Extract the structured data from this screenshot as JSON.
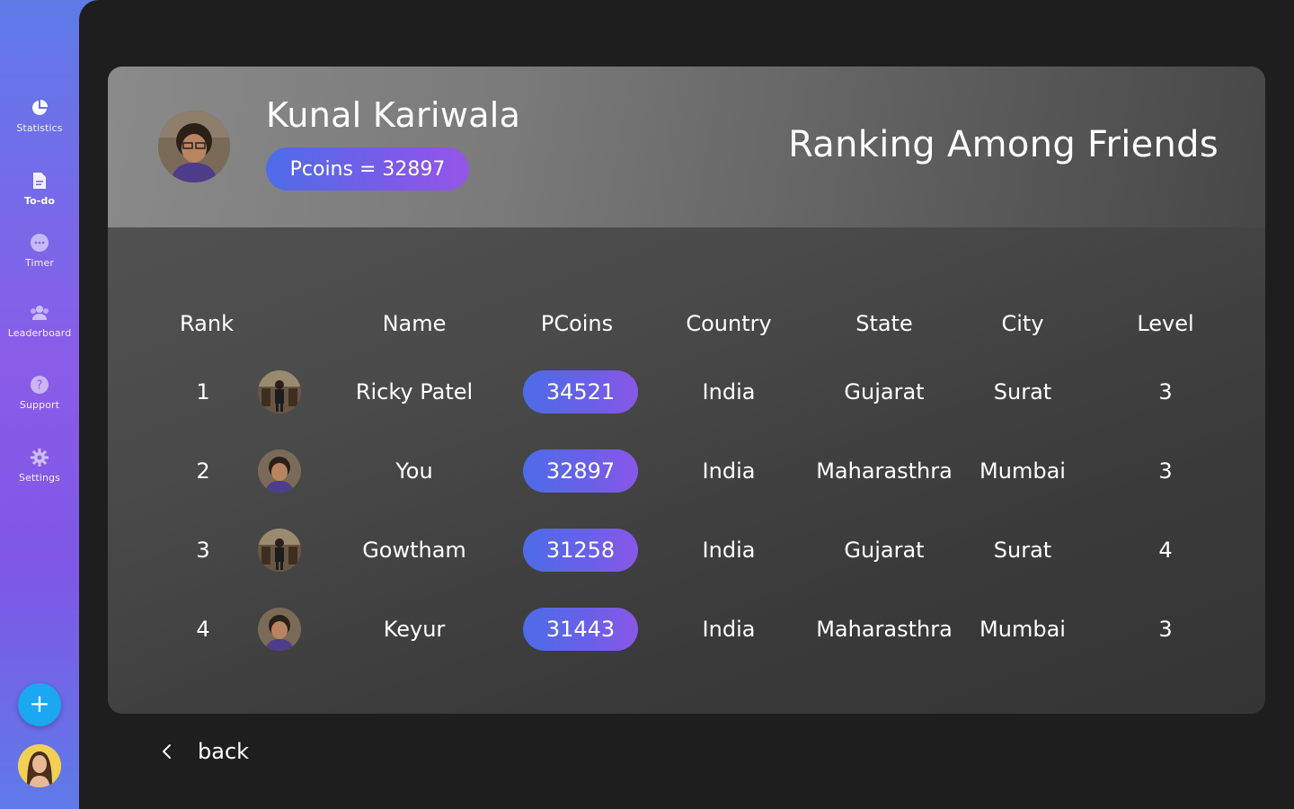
{
  "sidebar": {
    "items": [
      {
        "label": "Statistics",
        "icon": "pie-chart-icon"
      },
      {
        "label": "To-do",
        "icon": "document-icon"
      },
      {
        "label": "Timer",
        "icon": "chat-bubble-icon"
      },
      {
        "label": "Leaderboard",
        "icon": "group-icon"
      },
      {
        "label": "Support",
        "icon": "help-icon"
      },
      {
        "label": "Settings",
        "icon": "gear-icon"
      }
    ],
    "fab_label": "+"
  },
  "profile": {
    "name": "Kunal Kariwala",
    "pcoins_text": "Pcoins = 32897"
  },
  "header": {
    "title": "Ranking Among Friends"
  },
  "table": {
    "columns": [
      "Rank",
      "Name",
      "PCoins",
      "Country",
      "State",
      "City",
      "Level"
    ],
    "rows": [
      {
        "rank": "1",
        "name": "Ricky Patel",
        "pcoins": "34521",
        "country": "India",
        "state": "Gujarat",
        "city": "Surat",
        "level": "3"
      },
      {
        "rank": "2",
        "name": "You",
        "pcoins": "32897",
        "country": "India",
        "state": "Maharasthra",
        "city": "Mumbai",
        "level": "3"
      },
      {
        "rank": "3",
        "name": "Gowtham",
        "pcoins": "31258",
        "country": "India",
        "state": "Gujarat",
        "city": "Surat",
        "level": "4"
      },
      {
        "rank": "4",
        "name": "Keyur",
        "pcoins": "31443",
        "country": "India",
        "state": "Maharasthra",
        "city": "Mumbai",
        "level": "3"
      }
    ]
  },
  "footer": {
    "back_label": "back"
  },
  "colors": {
    "sidebar_top": "#5e7be8",
    "sidebar_mid": "#8a5ce8",
    "pill_start": "#4c6ce8",
    "pill_end": "#8a57e8",
    "fab": "#1aa8f0",
    "background": "#1e1e1e"
  }
}
